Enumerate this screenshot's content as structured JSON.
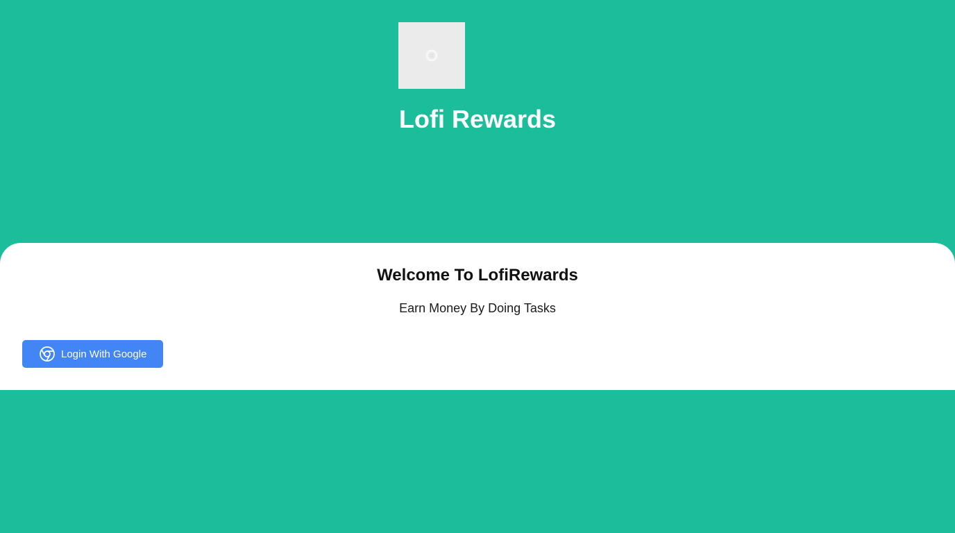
{
  "app": {
    "title": "Lofi Rewards",
    "logo_icon": "loading-spinner-icon"
  },
  "card": {
    "heading": "Welcome To LofiRewards",
    "subtitle": "Earn Money By Doing Tasks",
    "login_button": {
      "label": "Login With Google",
      "icon": "chrome-icon"
    }
  },
  "colors": {
    "background": "#1cbd9a",
    "card": "#ffffff",
    "button": "#4285f4"
  }
}
